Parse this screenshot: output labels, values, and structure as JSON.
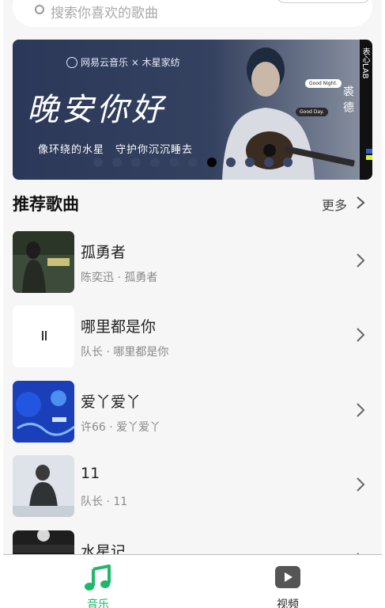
{
  "search": {
    "placeholder": "搜索你喜欢的歌曲"
  },
  "banner": {
    "brand": "网易云音乐 × 木星家纺",
    "headline": "晚安你好",
    "subline": "像环绕的水星　守护你沉沉睡去",
    "artist": "裘德",
    "bubble_1": "Good Night.",
    "bubble_2": "Good Day.",
    "side_text": "表心LAB",
    "slide_count": 11,
    "active_slide": 7
  },
  "section": {
    "title": "推荐歌曲",
    "more": "更多"
  },
  "songs": [
    {
      "title": "孤勇者",
      "subtitle": "陈奕迅 · 孤勇者"
    },
    {
      "title": "哪里都是你",
      "subtitle": "队长 · 哪里都是你"
    },
    {
      "title": "爱丫爱丫",
      "subtitle": "许66 · 爱丫爱丫"
    },
    {
      "title": "11",
      "subtitle": "队长 · 11"
    },
    {
      "title": "水星记",
      "subtitle": ""
    }
  ],
  "tabs": [
    {
      "label": "音乐",
      "icon": "music-note-icon",
      "active": true
    },
    {
      "label": "视频",
      "icon": "video-play-icon",
      "active": false
    }
  ],
  "colors": {
    "accent": "#1fb86a",
    "banner_bg": "#2c3859",
    "text_muted": "#888888"
  }
}
